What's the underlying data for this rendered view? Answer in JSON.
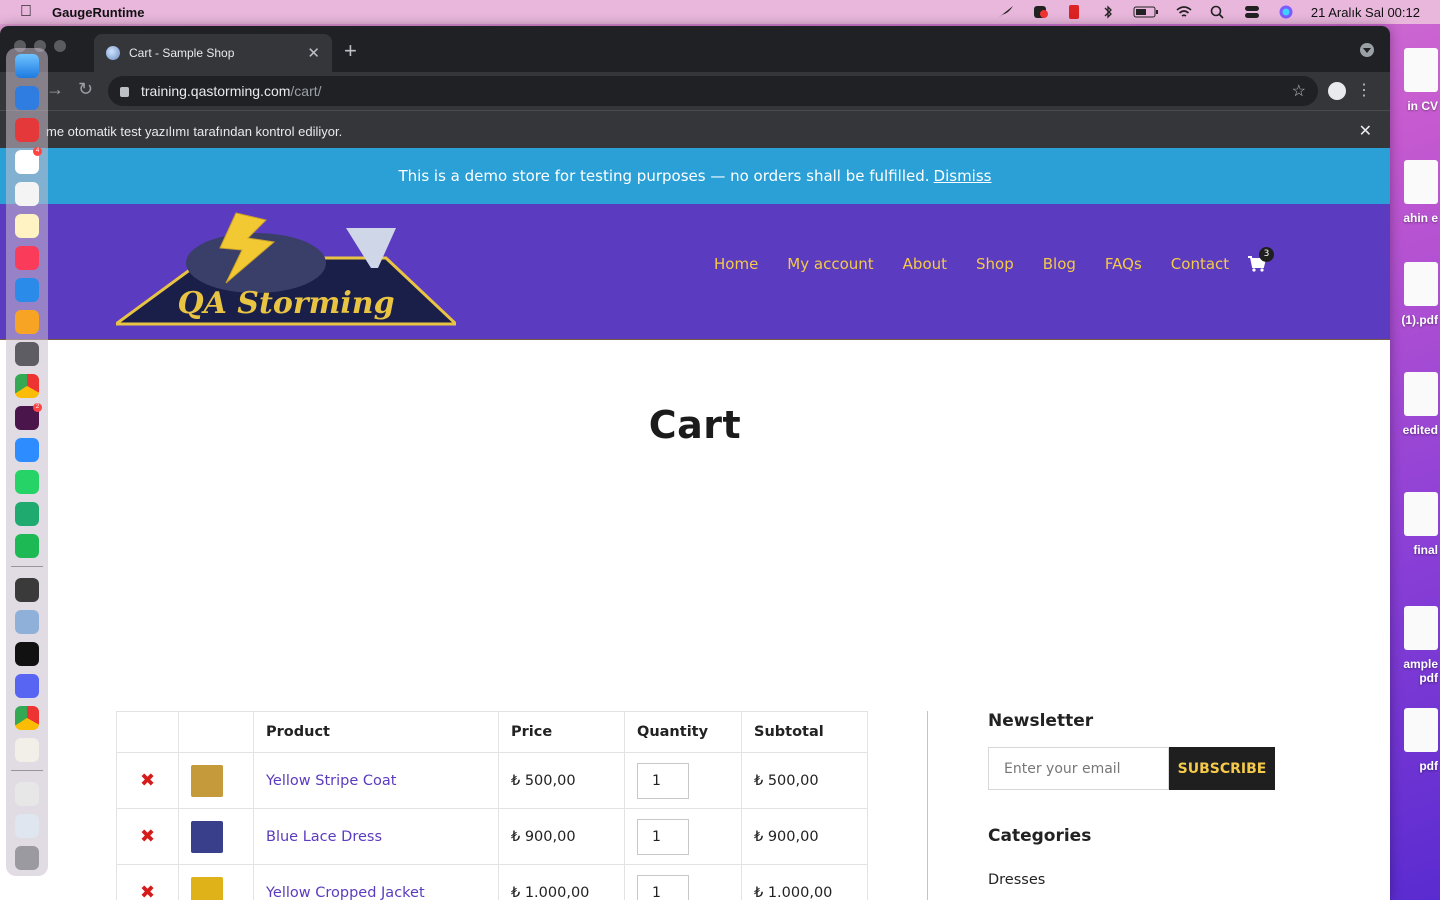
{
  "menubar": {
    "app_name": "GaugeRuntime",
    "datetime": "21 Aralık Sal  00:12"
  },
  "browser": {
    "tab_title": "Cart - Sample Shop",
    "url_host": "training.qastorming.com",
    "url_path": "/cart/",
    "info_message": "me otomatik test yazılımı tarafından kontrol ediliyor."
  },
  "site": {
    "demo_notice": "This is a demo store for testing purposes — no orders shall be fulfilled.",
    "dismiss_label": "Dismiss",
    "nav": [
      "Home",
      "My account",
      "About",
      "Shop",
      "Blog",
      "FAQs",
      "Contact"
    ],
    "cart_count": "3",
    "logo_text": "QA Storming"
  },
  "cart": {
    "title": "Cart",
    "headers": [
      "",
      "",
      "Product",
      "Price",
      "Quantity",
      "Subtotal"
    ],
    "remove_glyph": "✖",
    "rows": [
      {
        "product": "Yellow Stripe Coat",
        "price": "₺ 500,00",
        "qty": "1",
        "subtotal": "₺ 500,00",
        "thumb_color": "#c49a3a"
      },
      {
        "product": "Blue Lace Dress",
        "price": "₺ 900,00",
        "qty": "1",
        "subtotal": "₺ 900,00",
        "thumb_color": "#3a3f8c"
      },
      {
        "product": "Yellow Cropped Jacket",
        "price": "₺ 1.000,00",
        "qty": "1",
        "subtotal": "₺ 1.000,00",
        "thumb_color": "#e0b21a"
      }
    ]
  },
  "sidebar": {
    "newsletter_title": "Newsletter",
    "email_placeholder": "Enter your email",
    "subscribe_label": "SUBSCRIBE",
    "categories_title": "Categories",
    "categories": [
      "Dresses"
    ]
  },
  "desktop_files": [
    "in CV",
    "ahin e",
    "(1).pdf",
    "edited",
    "final",
    "ample pdf",
    "pdf"
  ],
  "colors": {
    "header_bg": "#5b3bbf",
    "demo_bar": "#2aa0d6",
    "nav_text": "#f5c94a"
  }
}
